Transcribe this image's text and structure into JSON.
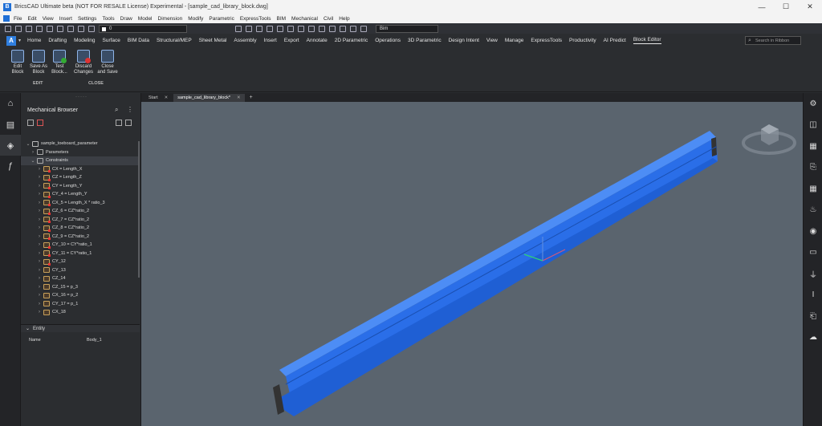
{
  "window": {
    "title": "BricsCAD Ultimate beta (NOT FOR RESALE License) Experimental - [sample_cad_library_block.dwg]",
    "app_logo": "B",
    "controls": [
      "—",
      "☐",
      "✕"
    ]
  },
  "menubar": {
    "items": [
      "File",
      "Edit",
      "View",
      "Insert",
      "Settings",
      "Tools",
      "Draw",
      "Model",
      "Dimension",
      "Modify",
      "Parametric",
      "ExpressTools",
      "BIM",
      "Mechanical",
      "Civil",
      "Help"
    ]
  },
  "quick_access": {
    "layer_value": "0",
    "workspace_value": "Bim"
  },
  "ribbon_tabs": {
    "logo": "A",
    "items": [
      "Home",
      "Drafting",
      "Modeling",
      "Surface",
      "BIM Data",
      "Structural/MEP",
      "Sheet Metal",
      "Assembly",
      "Insert",
      "Export",
      "Annotate",
      "2D Parametric",
      "Operations",
      "3D Parametric",
      "Design Intent",
      "View",
      "Manage",
      "ExpressTools",
      "Productivity",
      "AI Predict",
      "Block Editor"
    ],
    "active": "Block Editor",
    "search_placeholder": "Search in Ribbon"
  },
  "ribbon": {
    "edit_block": "Edit\nBlock",
    "save_as_block": "Save As\nBlock",
    "test_block": "Test\nBlock...",
    "discard_changes": "Discard\nChanges",
    "close_and_save": "Close\nand Save",
    "group_edit": "EDIT",
    "group_close": "CLOSE"
  },
  "browser": {
    "title": "Mechanical Browser",
    "root": "sample_toeboard_parameter",
    "parameters": "Parameters",
    "constraints": "Constraints",
    "items": [
      "CX = Length_X",
      "CZ = Length_Z",
      "CY = Length_Y",
      "CY_4 = Length_Y",
      "CX_5 = Length_X * ratio_3",
      "CZ_6 = CZ*ratio_2",
      "CZ_7 = CZ*ratio_2",
      "CZ_8 = CZ*ratio_2",
      "CZ_9 = CZ*ratio_2",
      "CY_10 = CY*ratio_1",
      "CY_11 = CY*ratio_1",
      "CY_12",
      "CY_13",
      "CZ_14",
      "CZ_15 = p_3",
      "CX_16 = p_2",
      "CY_17 = p_1",
      "CX_18"
    ],
    "entity_header": "Entity",
    "entity_name_label": "Name",
    "entity_name_value": "Body_1"
  },
  "doc_tabs": {
    "start": "Start",
    "active": "sample_cad_library_block*",
    "close": "✕",
    "add": "+"
  },
  "colors": {
    "beam": "#2a6ee8",
    "viewport_bg": "#5a646e",
    "panel_bg": "#2b2d30"
  }
}
